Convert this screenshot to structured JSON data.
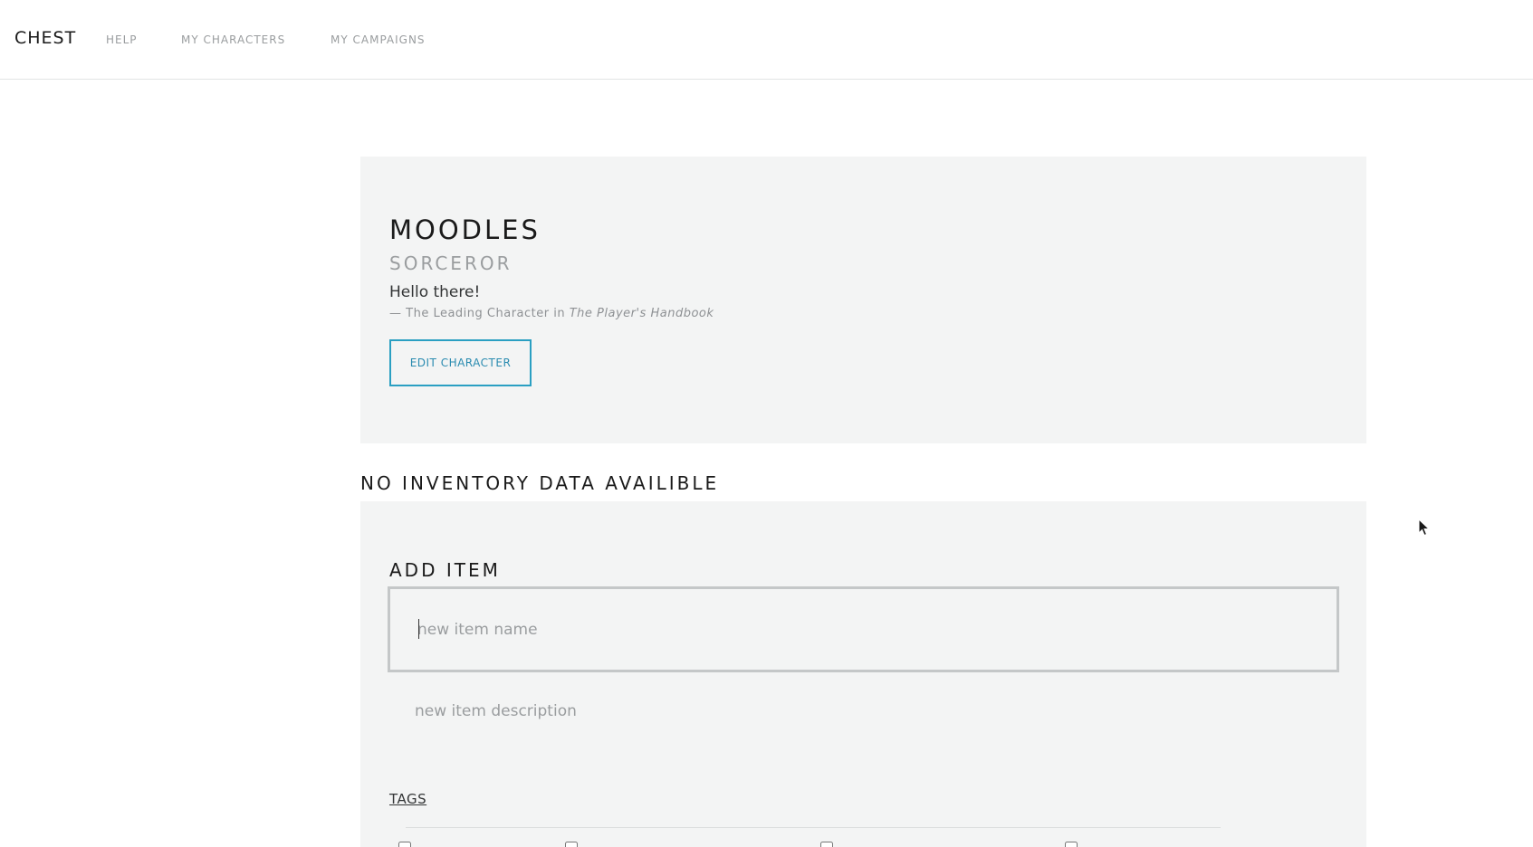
{
  "nav": {
    "brand": "CHEST",
    "links": [
      {
        "label": "HELP"
      },
      {
        "label": "MY CHARACTERS"
      },
      {
        "label": "MY CAMPAIGNS"
      }
    ]
  },
  "character": {
    "name": "MOODLES",
    "class": "SORCEROR",
    "quote": "Hello there!",
    "attribution_prefix": "—  The Leading Character in ",
    "attribution_source": "The Player's Handbook",
    "edit_label": "EDIT CHARACTER"
  },
  "inventory": {
    "empty_message": "NO INVENTORY DATA AVAILIBLE"
  },
  "add_item": {
    "title": "ADD ITEM",
    "name_placeholder": "new item name",
    "name_value": "",
    "description_placeholder": "new item description",
    "description_value": "",
    "tags_label": "TAGS"
  },
  "colors": {
    "accent": "#2a9fc2",
    "panel_bg": "#f3f4f4",
    "muted_text": "#9a9d9f"
  },
  "icons": {
    "cursor": "mouse-pointer-icon"
  }
}
